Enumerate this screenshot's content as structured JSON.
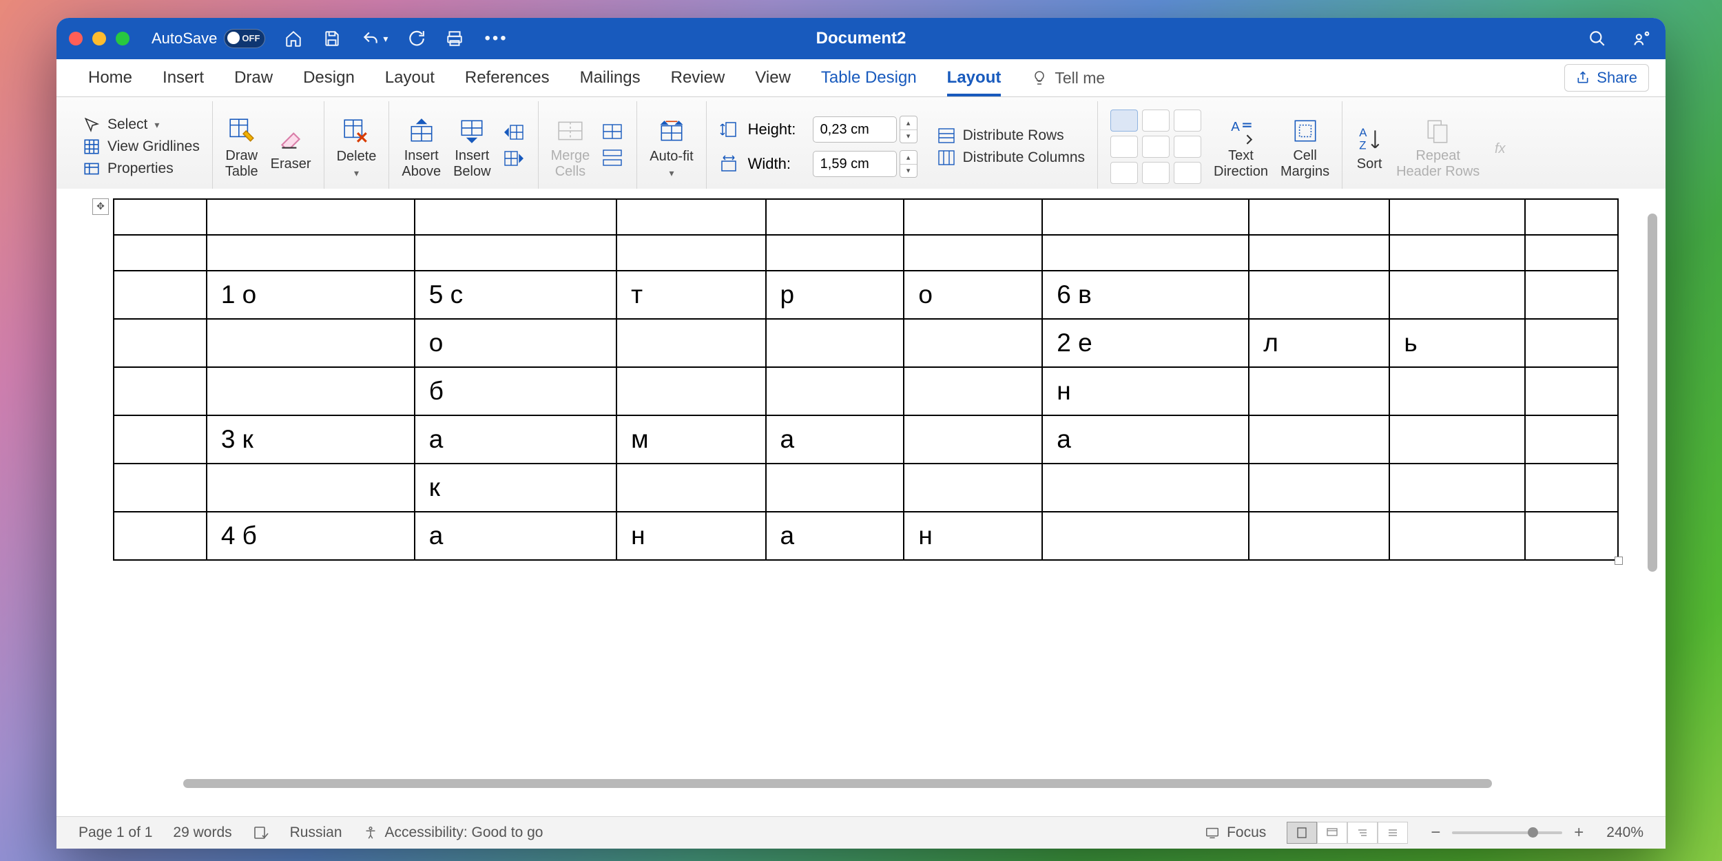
{
  "titlebar": {
    "autosave": "AutoSave",
    "autosave_state": "OFF",
    "document": "Document2"
  },
  "tabs": {
    "home": "Home",
    "insert": "Insert",
    "draw": "Draw",
    "design": "Design",
    "layout": "Layout",
    "references": "References",
    "mailings": "Mailings",
    "review": "Review",
    "view": "View",
    "table_design": "Table Design",
    "layout2": "Layout",
    "tellme": "Tell me",
    "share": "Share"
  },
  "ribbon": {
    "select": "Select",
    "gridlines": "View Gridlines",
    "properties": "Properties",
    "drawtable": "Draw\nTable",
    "eraser": "Eraser",
    "delete": "Delete",
    "ins_above": "Insert\nAbove",
    "ins_below": "Insert\nBelow",
    "merge": "Merge\nCells",
    "autofit": "Auto-fit",
    "height": "Height:",
    "width": "Width:",
    "h_val": "0,23 cm",
    "w_val": "1,59 cm",
    "dist_rows": "Distribute Rows",
    "dist_cols": "Distribute Columns",
    "text_dir": "Text\nDirection",
    "cell_marg": "Cell\nMargins",
    "sort": "Sort",
    "repeat_hdr": "Repeat\nHeader Rows"
  },
  "table": {
    "rows": [
      [
        "",
        "",
        "",
        "",
        "",
        "",
        "",
        "",
        "",
        ""
      ],
      [
        "",
        "",
        "",
        "",
        "",
        "",
        "",
        "",
        "",
        ""
      ],
      [
        "",
        "1 о",
        "5 с",
        "т",
        "р",
        "о",
        "6 в",
        "",
        "",
        ""
      ],
      [
        "",
        "",
        "о",
        "",
        "",
        "",
        "2 е",
        "л",
        "ь",
        ""
      ],
      [
        "",
        "",
        "б",
        "",
        "",
        "",
        "н",
        "",
        "",
        ""
      ],
      [
        "",
        "3 к",
        "а",
        "м",
        "а",
        "",
        "а",
        "",
        "",
        ""
      ],
      [
        "",
        "",
        "к",
        "",
        "",
        "",
        "",
        "",
        "",
        ""
      ],
      [
        "",
        "4 б",
        "а",
        "н",
        "а",
        "н",
        "",
        "",
        "",
        ""
      ]
    ]
  },
  "status": {
    "page": "Page 1 of 1",
    "words": "29 words",
    "lang": "Russian",
    "acc": "Accessibility: Good to go",
    "focus": "Focus",
    "zoom": "240%"
  }
}
